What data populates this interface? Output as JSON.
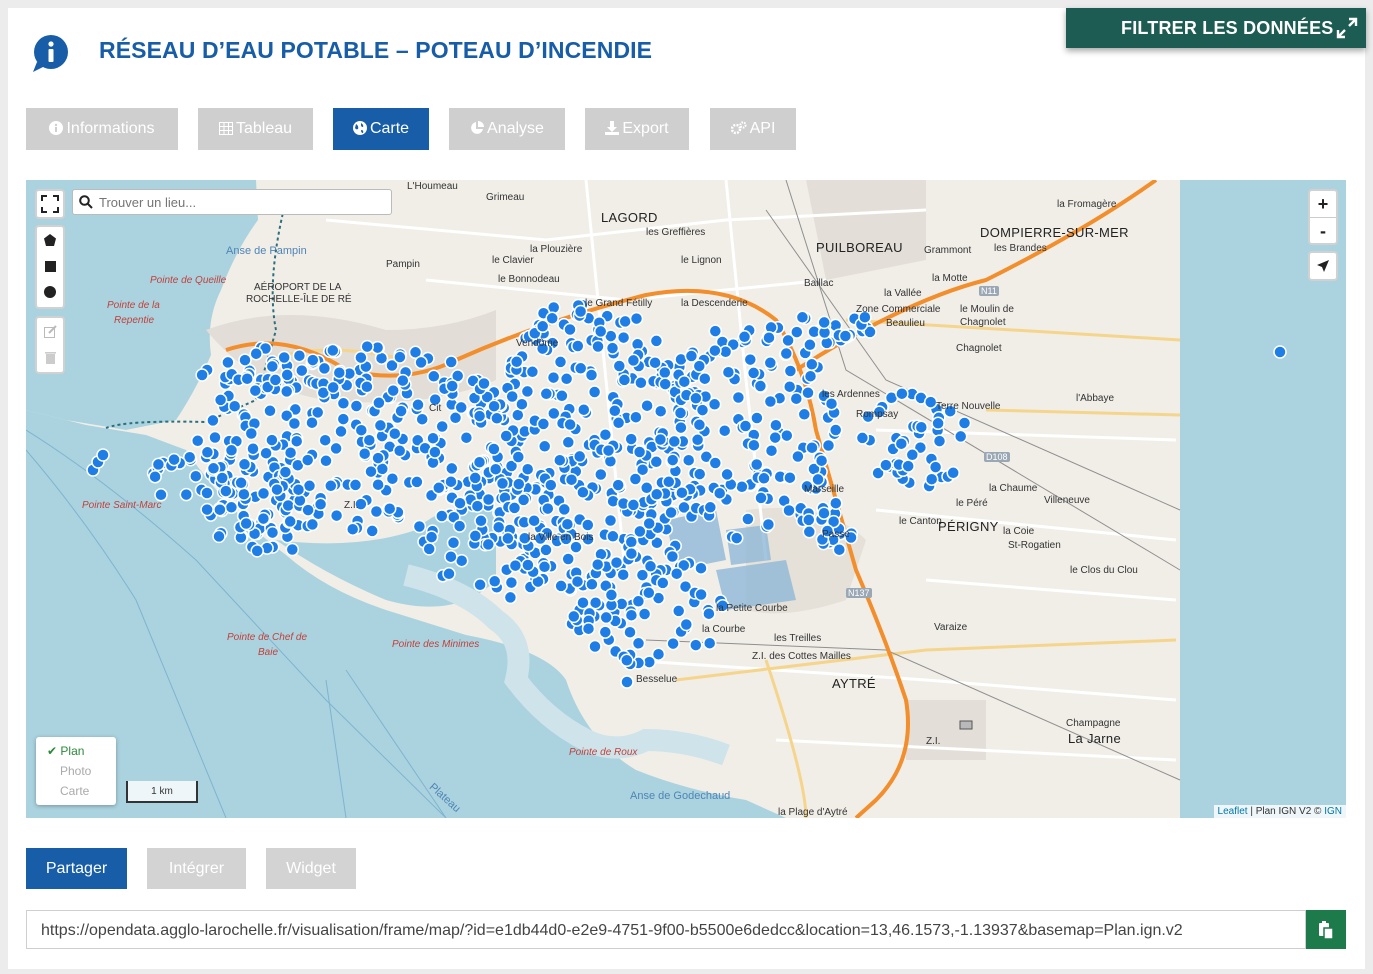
{
  "filter": {
    "label": "FILTRER LES DONNÉES",
    "icon": "expand-icon"
  },
  "page": {
    "title": "RÉSEAU D’EAU POTABLE – POTEAU D’INCENDIE",
    "icon": "info-icon"
  },
  "tabs": [
    {
      "label": "Informations",
      "icon": "info-circle-icon",
      "active": false
    },
    {
      "label": "Tableau",
      "icon": "table-icon",
      "active": false
    },
    {
      "label": "Carte",
      "icon": "globe-icon",
      "active": true
    },
    {
      "label": "Analyse",
      "icon": "pie-chart-icon",
      "active": false
    },
    {
      "label": "Export",
      "icon": "download-icon",
      "active": false
    },
    {
      "label": "API",
      "icon": "gears-icon",
      "active": false
    }
  ],
  "map": {
    "search_placeholder": "Trouver un lieu...",
    "zoom_in": "+",
    "zoom_out": "-",
    "basemaps": {
      "plan": "Plan",
      "photo": "Photo",
      "carte": "Carte",
      "selected": "Plan",
      "check": "✔"
    },
    "scale": "1 km",
    "attribution": {
      "leaflet": "Leaflet",
      "sep": " | Plan IGN V2 © ",
      "ign": "IGN"
    },
    "labels": {
      "houmeau": "L'Houmeau",
      "grimeau": "Grimeau",
      "lagord": "LAGORD",
      "greffieres": "les Greffières",
      "plouziere": "la Plouzière",
      "clavier": "le Clavier",
      "pampin": "Pampin",
      "lignon": "le Lignon",
      "bonnodeau": "le Bonnodeau",
      "grand_fetilly": "le Grand Fétilly",
      "descenderie": "la Descenderie",
      "vendome": "Vendôme",
      "puilboreau": "PUILBOREAU",
      "grammont": "Grammont",
      "dompierre": "DOMPIERRE-SUR-MER",
      "fromagere": "la Fromagère",
      "brandes": "les Brandes",
      "motte": "la Motte",
      "bailac": "Baillac",
      "vallee": "la Vallée",
      "zone_co": "Zone Commerciale",
      "beaulieu": "Beaulieu",
      "moulin": "le Moulin de",
      "chagnolet": "Chagnolet",
      "chagnolet2": "Chagnolet",
      "n11": "N11",
      "anse_pampin": "Anse de Pampin",
      "pointe_queille": "Pointe de Queille",
      "aeroport": "AÉROPORT DE LA",
      "aeroport2": "ROCHELLE-ÎLE DE RÉ",
      "pointe_repentie": "Pointe de la",
      "repentie": "Repentie",
      "ardennes": "les Ardennes",
      "rompsay": "Rompsay",
      "terre_nouvelle": "Terre Nouvelle",
      "abbaye": "l'Abbaye",
      "d108": "D108",
      "chaume": "la Chaume",
      "villeneuve": "Villeneuve",
      "pere": "le Péré",
      "canton": "le Canton",
      "perigny": "PÉRIGNY",
      "coie": "la Coie",
      "st_rogatien": "St-Rogatien",
      "clos_clou": "le Clos du Clou",
      "pointe_st_marc": "Pointe Saint-Marc",
      "zi": "Z.I.",
      "ville_en_bois": "la Ville en Bois",
      "petite_courbe": "la Petite Courbe",
      "courbe": "la Courbe",
      "treilles": "les Treilles",
      "cottes": "Z.I. des Cottes Mailles",
      "n137": "N137",
      "varaize": "Varaize",
      "aytre": "AYTRÉ",
      "chef_de_baie": "Pointe de Chef de",
      "baie": "Baie",
      "pointe_minimes": "Pointe des Minimes",
      "besselue": "Besselue",
      "pointe_roux": "Pointe de Roux",
      "anse_godechaud": "Anse de Godechaud",
      "plateau": "Plateau",
      "champagne": "Champagne",
      "la_jarne": "La Jarne",
      "zi2": "Z.I.",
      "plage_aytre": "la Plage d'Aytré",
      "passe": "Passe",
      "marseille": "Marseille",
      "cite": "Cit"
    }
  },
  "share": {
    "buttons": [
      {
        "label": "Partager",
        "active": true
      },
      {
        "label": "Intégrer",
        "active": false
      },
      {
        "label": "Widget",
        "active": false
      }
    ],
    "url": "https://opendata.agglo-larochelle.fr/visualisation/frame/map/?id=e1db44d0-e2e9-4751-9f00-b5500e6dedcc&location=13,46.1573,-1.13937&basemap=Plan.ign.v2",
    "copy_icon": "clipboard-icon"
  },
  "colors": {
    "primary": "#175da7",
    "filter": "#1d5c52",
    "copy": "#1d7a4a",
    "marker": "#1e7ee6",
    "sea": "#aad3df",
    "tab_inactive": "#cfcfcf"
  }
}
